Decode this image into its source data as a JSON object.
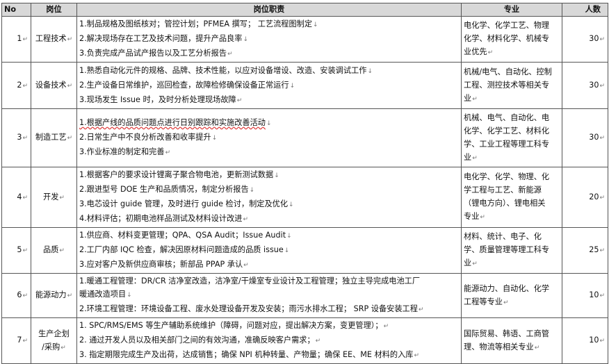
{
  "header": {
    "no": "No",
    "position": "岗位",
    "duties": "岗位职责",
    "major": "专业",
    "count": "人数"
  },
  "rows": [
    {
      "no": "1",
      "position": "工程技术",
      "duties": [
        "1.制品规格及图纸核对；管控计划；PFMEA 撰写；  工艺流程图制定",
        "2.解决现场存在工艺及技术问题，提升产品良率",
        "3.负责完成产品试产报告以及工艺分析报告"
      ],
      "major_lines": [
        "电化学、化学工艺、物理",
        "化学、材料化学、机械专",
        "业优先"
      ],
      "count": "30"
    },
    {
      "no": "2",
      "position": "设备技术",
      "duties": [
        "1.熟悉自动化元件的规格、品牌、技术性能，以应对设备增设、改造、安装调试工作",
        "2.生产设备日常维护，巡回检查，故障检修确保设备正常运行",
        "3.现场发生 Issue 时，及时分析处理现场故障"
      ],
      "major_lines": [
        "机械/电气、自动化、控制",
        "工程、测控技术等相关专",
        "业"
      ],
      "count": "30"
    },
    {
      "no": "3",
      "position": "制造工艺",
      "duties": [
        "1.根据产线的品质问题点进行日别跟踪和实施改善活动",
        "2.日常生产中不良分析改善和收率提升",
        "3.作业标准的制定和完善"
      ],
      "major_lines": [
        "机械、电气、自动化、电",
        "化学、化学工艺、材料化",
        "学、工业工程等理工科专",
        "业"
      ],
      "count": "30"
    },
    {
      "no": "4",
      "position": "开发",
      "duties": [
        "1.根据客户的要求设计锂离子聚合物电池，更新测试数据",
        "2.跟进型号 DOE 生产和品质情况，制定分析报告",
        "3.电芯设计 guide 管理，及时进行 guide 检讨，制定及优化",
        "4.材料评估；初期电池样品测试及材料设计改进"
      ],
      "major_lines": [
        "电化学、化学、物理、化",
        "学工程与工艺、新能源",
        "（锂电方向）、锂电相关",
        "专业"
      ],
      "count": "20"
    },
    {
      "no": "5",
      "position": "品质",
      "duties": [
        "1.供应商、材料变更管理；QPA、QSA Audit；Issue Audit",
        "2.工厂内部 IQC 检查，解决因原材料问题造成的品质 issue",
        "3.应对客户及新供应商审核；新部品 PPAP 承认"
      ],
      "major_lines": [
        "材料、统计、电子、化",
        "学、质量管理等理工科专",
        "业"
      ],
      "count": "25"
    },
    {
      "no": "6",
      "position": "能源动力",
      "duties": [
        "1.暖通工程管理：DR/CR 洁净室改造，洁净室/干燥室专业设计及工程管理；独立主导完成电池工厂",
        "暖通改造项目",
        "2.环境工程管理：环境设备工程、废水处理设备开发及安装；雨污水排水工程；  SRP 设备安装工程"
      ],
      "major_lines": [
        "能源动力、自动化、化学",
        "工程等专业"
      ],
      "count": "10"
    },
    {
      "no": "7",
      "position": "生产企划/采购",
      "position_lines": [
        "生产企划",
        "/采购"
      ],
      "duties": [
        "1. SPC/RMS/EMS 等生产辅助系统维护（障碍，问题对应，提出解决方案，变更管理）；",
        "2. 通过开发人员以及相关部门之间的有效沟通，准确反映客户需求；",
        "3. 指定期限完成生产及出荷，达成销售；确保 NPI 机种转量、产物量；确保 EE、ME 材料的入库"
      ],
      "major_lines": [
        "国际贸易、韩语、工商管",
        "理、物流等相关专业"
      ],
      "count": "10"
    }
  ]
}
